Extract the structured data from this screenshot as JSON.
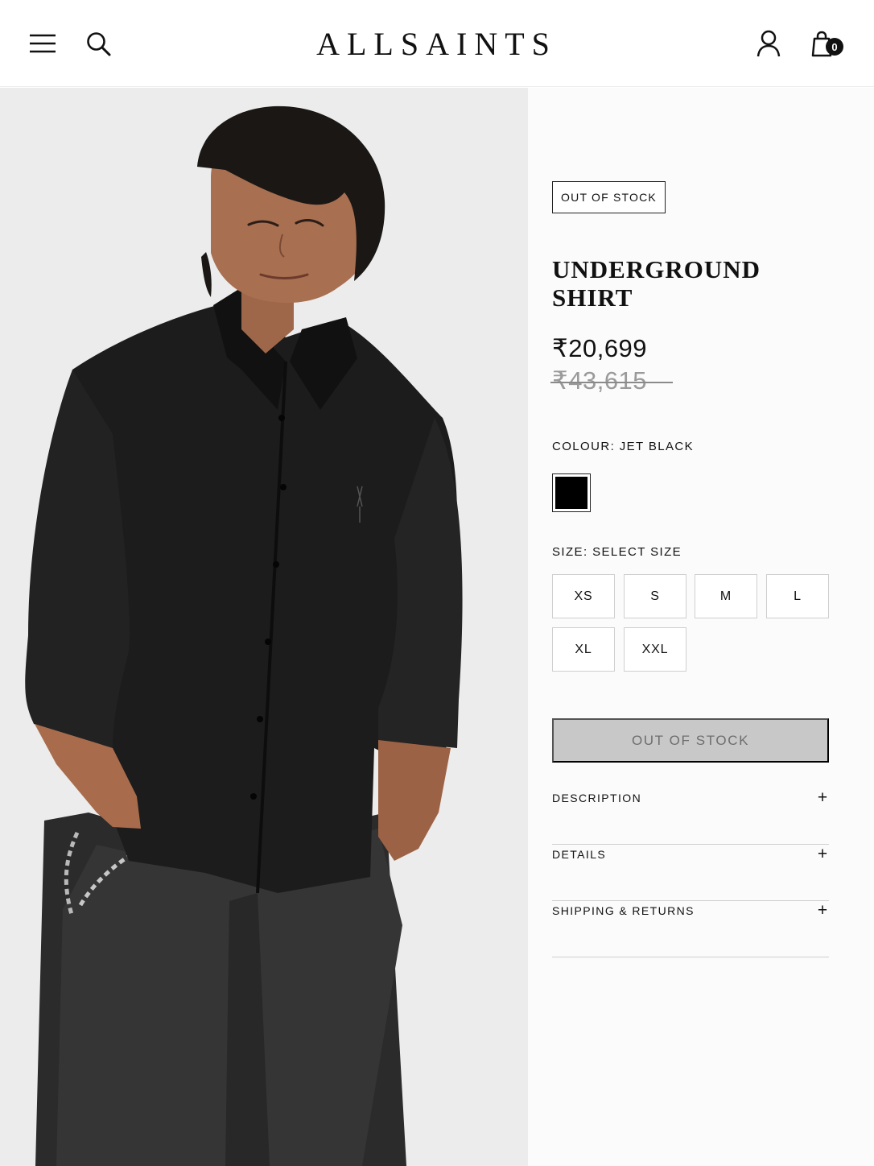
{
  "header": {
    "logo": "ALLSAINTS",
    "menu_icon": "hamburger-menu-icon",
    "search_icon": "search-icon",
    "account_icon": "user-account-icon",
    "bag_icon": "shopping-bag-icon",
    "bag_count": "0"
  },
  "product_image": {
    "icon": "product-photo",
    "background": "#ececec"
  },
  "product": {
    "stock_badge": "OUT OF STOCK",
    "title": "UNDERGROUND SHIRT",
    "price_current": "₹20,699",
    "price_original": "₹43,615",
    "colour_label": "COLOUR: JET BLACK",
    "colour_swatch": "#000000",
    "size_label": "SIZE: SELECT SIZE",
    "sizes": [
      "XS",
      "S",
      "M",
      "L",
      "XL",
      "XXL"
    ],
    "cta_label": "OUT OF STOCK",
    "accordions": [
      {
        "label": "DESCRIPTION",
        "icon": "plus-icon",
        "symbol": "+"
      },
      {
        "label": "DETAILS",
        "icon": "plus-icon",
        "symbol": "+"
      },
      {
        "label": "SHIPPING & RETURNS",
        "icon": "plus-icon",
        "symbol": "+"
      }
    ]
  },
  "colors": {
    "text": "#111111",
    "muted": "#9a9a9a",
    "disabled_button": "#c8c8c8",
    "divider": "#cfcfcf"
  }
}
